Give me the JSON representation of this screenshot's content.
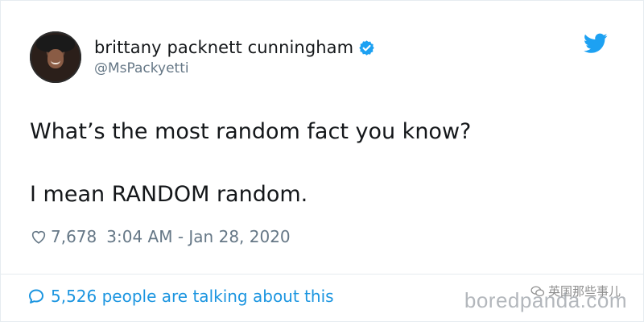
{
  "tweet": {
    "display_name": "brittany packnett cunningham",
    "handle": "@MsPackyetti",
    "text_line1": "What’s the most random fact you know?",
    "text_line2": "I mean RANDOM random.",
    "likes": "7,678",
    "timestamp": "3:04 AM - Jan 28, 2020",
    "talking": "5,526 people are talking about this"
  },
  "watermarks": {
    "site": "boredpanda.com",
    "cn": "英国那些事儿"
  },
  "colors": {
    "twitter_blue": "#1da1f2",
    "link_blue": "#1b95e0",
    "text": "#14171a",
    "muted": "#657786"
  },
  "icons": [
    "avatar",
    "verified-badge-icon",
    "twitter-bird-icon",
    "heart-icon",
    "comment-bubble-icon",
    "wechat-icon"
  ]
}
